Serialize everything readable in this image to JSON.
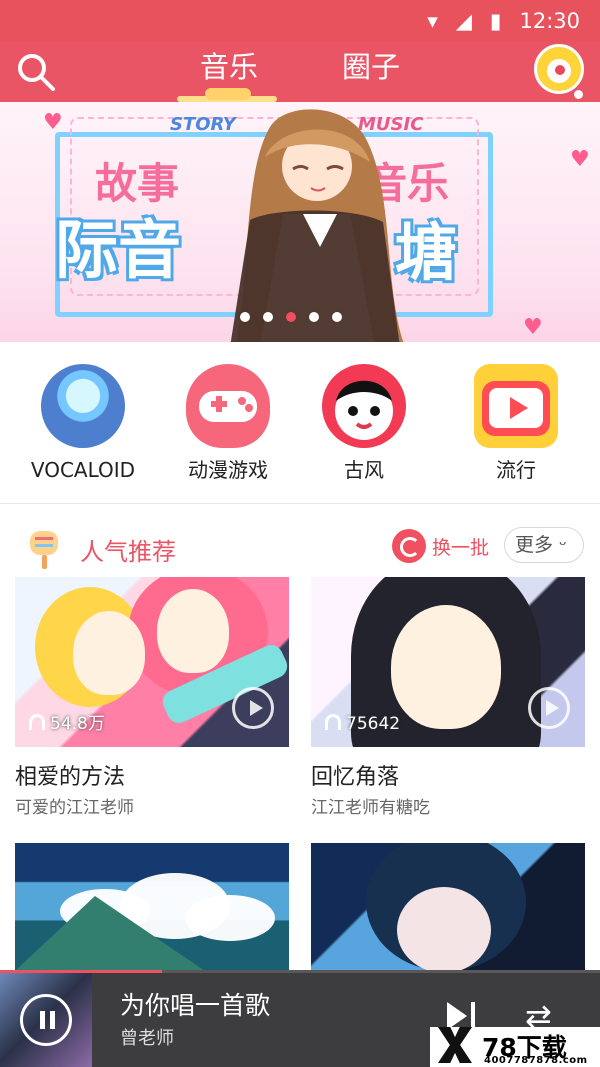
{
  "status_bar": {
    "time": "12:30",
    "icons": [
      "wifi-icon",
      "signal-icon",
      "battery-icon"
    ]
  },
  "top_nav": {
    "tabs": [
      {
        "label": "音乐",
        "active": true
      },
      {
        "label": "圈子",
        "active": false
      }
    ],
    "search_icon": "search-icon",
    "profile_icon": "profile-icon"
  },
  "banner": {
    "story_label": "STORY",
    "music_label": "MUSIC",
    "text_left_top": "故事",
    "text_left_bottom": "际音",
    "text_right_top": "音乐",
    "text_right_bottom": "塘",
    "dots": 5,
    "active_dot": 3
  },
  "categories": [
    {
      "label": "VOCALOID",
      "icon": "vocaloid-icon"
    },
    {
      "label": "动漫游戏",
      "icon": "gamepad-icon"
    },
    {
      "label": "古风",
      "icon": "opera-mask-icon"
    },
    {
      "label": "流行",
      "icon": "tv-play-icon"
    }
  ],
  "recommend": {
    "title": "人气推荐",
    "refresh_label": "换一批",
    "more_label": "更多",
    "cards": [
      {
        "title": "相爱的方法",
        "author": "可爱的江江老师",
        "plays": "54.8万"
      },
      {
        "title": "回忆角落",
        "author": "江江老师有糖吃",
        "plays": "75642"
      }
    ]
  },
  "player": {
    "title": "为你唱一首歌",
    "artist": "曾老师",
    "progress": 0.27
  },
  "watermark": {
    "main": "78下载",
    "sub": "4007787878.com"
  },
  "colors": {
    "accent": "#ea5565",
    "player_background": "#3d3d3f"
  }
}
